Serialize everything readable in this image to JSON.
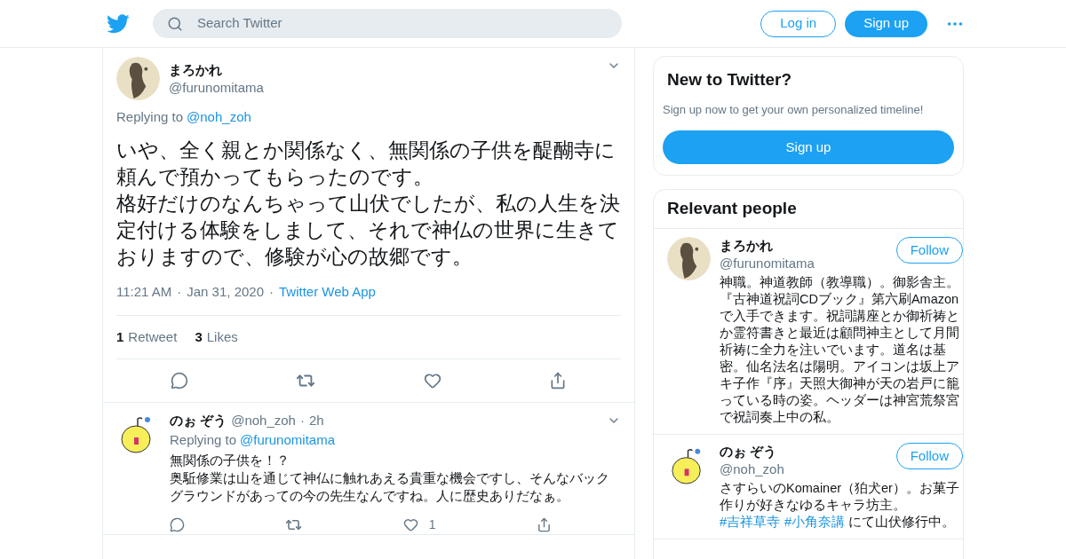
{
  "header": {
    "search": {
      "placeholder": "Search Twitter"
    },
    "buttons": [
      {
        "label": "Log in",
        "kind": "outline"
      },
      {
        "label": "Sign up",
        "kind": "solid"
      }
    ]
  },
  "main_tweet": {
    "kind": "sketch",
    "separator": "·",
    "name": "まろかれ",
    "handle": "@furunomitama",
    "replying_label": "Replying to",
    "replying_to": "@noh_zoh",
    "paragraphs": [
      "いや、全く親とか関係なく、無関係の子供を醍醐寺に頼んで預かってもらったのです。",
      "格好だけのなんちゃって山伏でしたが、私の人生を決定付ける体験をしまして、それで神仏の世界に生きておりますので、修験が心の故郷です。"
    ],
    "time": "11:21 AM",
    "date": "Jan 31, 2020",
    "source": "Twitter Web App",
    "stats": [
      {
        "count": "1",
        "label": "Retweet"
      },
      {
        "count": "3",
        "label": "Likes"
      }
    ]
  },
  "replies": [
    {
      "kind": "chick",
      "separator": "·",
      "name": "のぉ ぞう",
      "handle": "@noh_zoh",
      "age": "2h",
      "replying_label": "Replying to",
      "replying_to": "@furunomitama",
      "paragraphs": [
        "無関係の子供を！？",
        "奥駈修業は山を通じて神仏に触れあえる貴重な機会ですし、そんなバックグラウンドがあっての今の先生なんですね。人に歴史ありだなぁ。"
      ],
      "like_count": "1"
    }
  ],
  "signup_card": {
    "title": "New to Twitter?",
    "text": "Sign up now to get your own personalized timeline!",
    "button": "Sign up"
  },
  "relevant_people": {
    "title": "Relevant people",
    "people": [
      {
        "name": "まろかれ",
        "handle": "@furunomitama",
        "kind": "sketch",
        "button": "Follow",
        "bio": [
          {
            "text": "神職。神道教師（教導職）。御影舎主。『古神道祝詞CDブック』第六刷Amazonで入手できます。祝詞講座とか御祈祷とか霊符書きと最近は顧問神主として月間祈祷に全力を注いでいます。道名は基密。仙名法名は陽明。アイコンは坂上アキ子作『序』天照大御神が天の岩戸に籠っている時の姿。ヘッダーは神宮荒祭宮で祝詞奏上中の私。",
            "link": false
          }
        ]
      },
      {
        "name": "のぉ ぞう",
        "handle": "@noh_zoh",
        "kind": "chick",
        "button": "Follow",
        "bio": [
          {
            "text": "さすらいのKomainer（狛犬er）。お菓子作りが好きなゆるキャラ坊主。",
            "link": false
          },
          {
            "text": "#吉祥草寺",
            "link": true
          },
          {
            "text": "#小角奈講",
            "link": true
          },
          {
            "text": " にて山伏修行中。",
            "link": false
          }
        ]
      }
    ]
  }
}
